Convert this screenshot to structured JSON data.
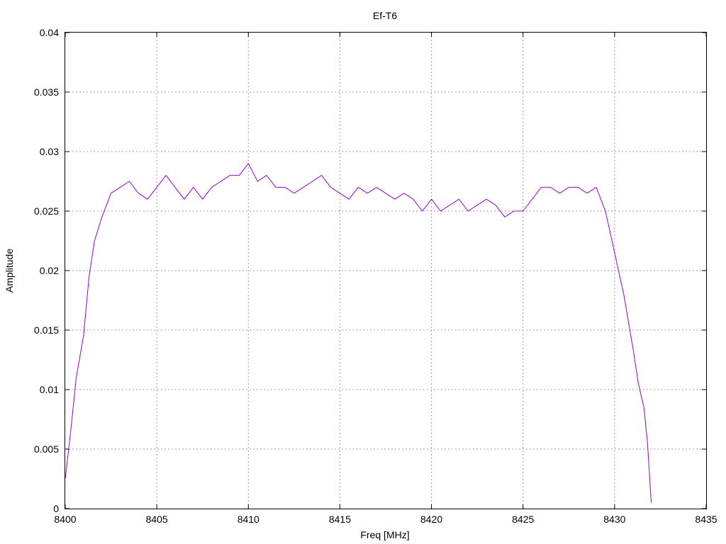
{
  "chart_data": {
    "type": "line",
    "title": "Ef-T6",
    "xlabel": "Freq [MHz]",
    "ylabel": "Amplitude",
    "xlim": [
      8400,
      8435
    ],
    "ylim": [
      0,
      0.04
    ],
    "grid": true,
    "x_ticks": [
      "8400",
      "8405",
      "8410",
      "8415",
      "8420",
      "8425",
      "8430",
      "8435"
    ],
    "y_ticks": [
      "0",
      "0.005",
      "0.01",
      "0.015",
      "0.02",
      "0.025",
      "0.03",
      "0.035",
      "0.04"
    ],
    "series": [
      {
        "color": "#9400d3",
        "x": [
          8400.0,
          8400.3,
          8400.6,
          8401.0,
          8401.3,
          8401.6,
          8402.0,
          8402.5,
          8403.0,
          8403.5,
          8404.0,
          8404.5,
          8405.0,
          8405.5,
          8406.0,
          8406.5,
          8407.0,
          8407.5,
          8408.0,
          8408.5,
          8409.0,
          8409.5,
          8410.0,
          8410.5,
          8411.0,
          8411.5,
          8412.0,
          8412.5,
          8413.0,
          8413.5,
          8414.0,
          8414.5,
          8415.0,
          8415.5,
          8416.0,
          8416.5,
          8417.0,
          8417.5,
          8418.0,
          8418.5,
          8419.0,
          8419.5,
          8420.0,
          8420.5,
          8421.0,
          8421.5,
          8422.0,
          8422.5,
          8423.0,
          8423.5,
          8424.0,
          8424.5,
          8425.0,
          8425.5,
          8426.0,
          8426.5,
          8427.0,
          8427.5,
          8428.0,
          8428.5,
          8429.0,
          8429.5,
          8430.0,
          8430.5,
          8431.0,
          8431.3,
          8431.6,
          8431.8,
          8432.0
        ],
        "values": [
          0.0025,
          0.0065,
          0.011,
          0.0145,
          0.0195,
          0.0225,
          0.0245,
          0.0265,
          0.027,
          0.0275,
          0.0265,
          0.026,
          0.027,
          0.028,
          0.027,
          0.026,
          0.027,
          0.026,
          0.027,
          0.0275,
          0.028,
          0.028,
          0.029,
          0.0275,
          0.028,
          0.027,
          0.027,
          0.0265,
          0.027,
          0.0275,
          0.028,
          0.027,
          0.0265,
          0.026,
          0.027,
          0.0265,
          0.027,
          0.0265,
          0.026,
          0.0265,
          0.026,
          0.025,
          0.026,
          0.025,
          0.0255,
          0.026,
          0.025,
          0.0255,
          0.026,
          0.0255,
          0.0245,
          0.025,
          0.025,
          0.026,
          0.027,
          0.027,
          0.0265,
          0.027,
          0.027,
          0.0265,
          0.027,
          0.025,
          0.0215,
          0.018,
          0.0135,
          0.0105,
          0.0085,
          0.0055,
          0.0005
        ]
      }
    ]
  }
}
